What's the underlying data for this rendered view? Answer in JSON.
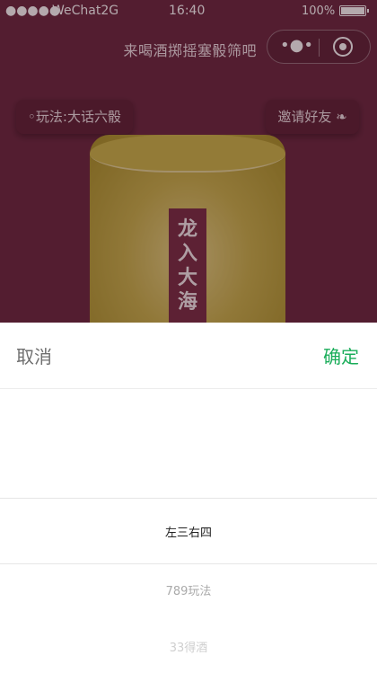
{
  "status_bar": {
    "signal": "●●●●●",
    "carrier": "WeChat2G",
    "time": "16:40",
    "battery": "100%"
  },
  "navbar": {
    "title": "来喝酒掷摇塞骰筛吧",
    "more_glyph": "•●•"
  },
  "buttons": {
    "rules": "◦玩法:大话六骰",
    "invite": "邀请好友 ❧"
  },
  "cup": {
    "banner_chars": [
      "龙",
      "入",
      "大",
      "海"
    ]
  },
  "picker": {
    "cancel": "取消",
    "confirm": "确定",
    "options": [
      "左三右四",
      "789玩法",
      "33得酒"
    ],
    "selected_index": 0
  },
  "colors": {
    "background": "#6b2940",
    "confirm": "#1aad5a",
    "cancel": "#6f6f6f",
    "cup": "#c9b44c"
  }
}
